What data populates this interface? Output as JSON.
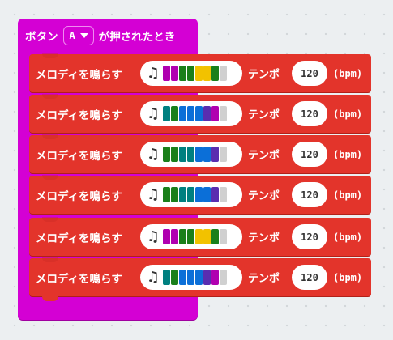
{
  "event": {
    "label": "ボタン",
    "button_value": "A",
    "suffix": "が押されたとき"
  },
  "melody_blocks": [
    {
      "label": "メロディを鳴らす",
      "tempo_label": "テンポ",
      "tempo": "120",
      "unit": "(bpm)",
      "notes": [
        "#b000b0",
        "#b000b0",
        "#1a7f1a",
        "#1a7f1a",
        "#f2c200",
        "#f2c200",
        "#1a7f1a",
        "#d0d0d0"
      ]
    },
    {
      "label": "メロディを鳴らす",
      "tempo_label": "テンポ",
      "tempo": "120",
      "unit": "(bpm)",
      "notes": [
        "#008080",
        "#1a7f1a",
        "#0b6fd8",
        "#0b6fd8",
        "#0b6fd8",
        "#5a2db0",
        "#b000b0",
        "#d0d0d0"
      ]
    },
    {
      "label": "メロディを鳴らす",
      "tempo_label": "テンポ",
      "tempo": "120",
      "unit": "(bpm)",
      "notes": [
        "#1a7f1a",
        "#1a7f1a",
        "#008080",
        "#008080",
        "#0b6fd8",
        "#0b6fd8",
        "#5a2db0",
        "#d0d0d0"
      ]
    },
    {
      "label": "メロディを鳴らす",
      "tempo_label": "テンポ",
      "tempo": "120",
      "unit": "(bpm)",
      "notes": [
        "#1a7f1a",
        "#1a7f1a",
        "#008080",
        "#008080",
        "#0b6fd8",
        "#0b6fd8",
        "#5a2db0",
        "#d0d0d0"
      ]
    },
    {
      "label": "メロディを鳴らす",
      "tempo_label": "テンポ",
      "tempo": "120",
      "unit": "(bpm)",
      "notes": [
        "#b000b0",
        "#b000b0",
        "#1a7f1a",
        "#1a7f1a",
        "#f2c200",
        "#f2c200",
        "#1a7f1a",
        "#d0d0d0"
      ]
    },
    {
      "label": "メロディを鳴らす",
      "tempo_label": "テンポ",
      "tempo": "120",
      "unit": "(bpm)",
      "notes": [
        "#008080",
        "#1a7f1a",
        "#0b6fd8",
        "#0b6fd8",
        "#0b6fd8",
        "#5a2db0",
        "#b000b0",
        "#d0d0d0"
      ]
    }
  ],
  "icons": {
    "note": "music-note-icon",
    "dropdown": "chevron-down-icon"
  },
  "colors": {
    "event_block": "#d400d4",
    "melody_block": "#e3342b",
    "workspace": "#eceff1"
  }
}
